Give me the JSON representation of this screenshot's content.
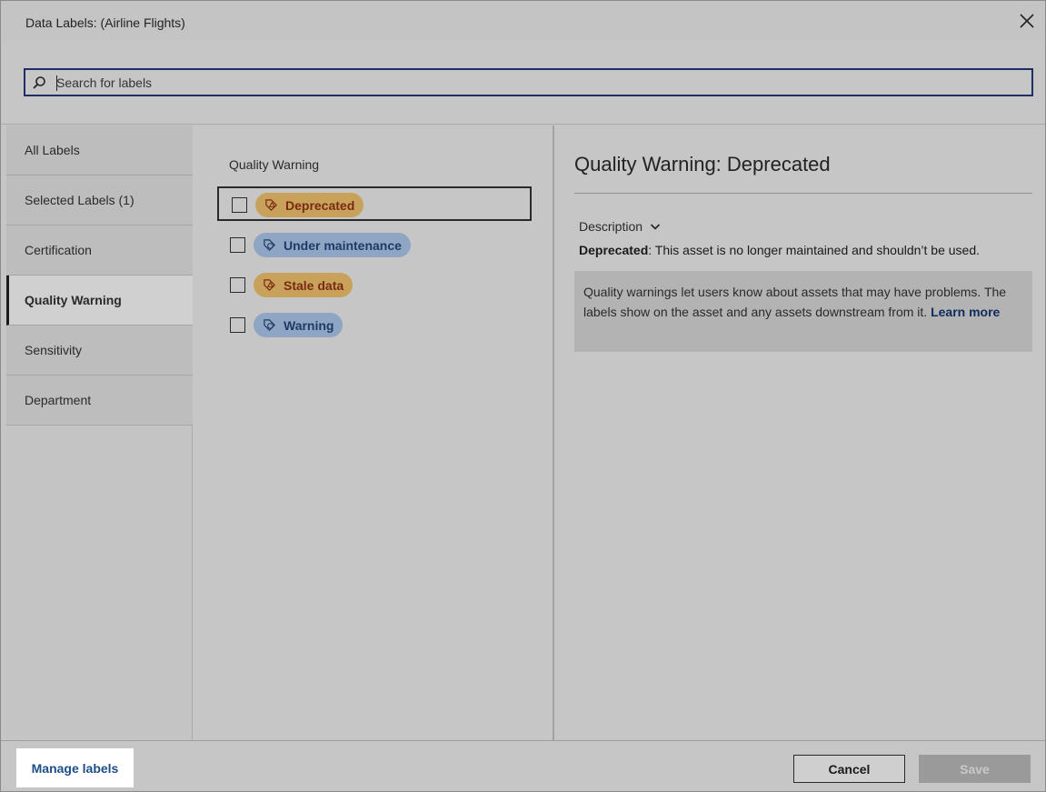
{
  "dialog": {
    "title": "Data Labels: (Airline Flights)"
  },
  "search": {
    "placeholder": "Search for labels",
    "value": ""
  },
  "sidebar": {
    "items": [
      {
        "label": "All Labels",
        "active": false
      },
      {
        "label": "Selected Labels (1)",
        "active": false
      },
      {
        "label": "Certification",
        "active": false
      },
      {
        "label": "Quality Warning",
        "active": true
      },
      {
        "label": "Sensitivity",
        "active": false
      },
      {
        "label": "Department",
        "active": false
      }
    ]
  },
  "labels_panel": {
    "group_title": "Quality Warning",
    "labels": [
      {
        "name": "Deprecated",
        "icon": "warning-tag-icon",
        "variant": "warn",
        "checked": false,
        "focused": true
      },
      {
        "name": "Under maintenance",
        "icon": "info-tag-icon",
        "variant": "info",
        "checked": false,
        "focused": false
      },
      {
        "name": "Stale data",
        "icon": "warning-tag-icon",
        "variant": "warn",
        "checked": false,
        "focused": false
      },
      {
        "name": "Warning",
        "icon": "info-tag-icon",
        "variant": "info",
        "checked": false,
        "focused": false
      }
    ]
  },
  "detail": {
    "title": "Quality Warning: Deprecated",
    "description_toggle": "Description",
    "description_term": "Deprecated",
    "description_text": ": This asset is no longer maintained and shouldn’t be used.",
    "info_text": "Quality warnings let users know about assets that may have problems. The labels show on the asset and any assets downstream from it.",
    "learn_more": "Learn more"
  },
  "footer": {
    "manage_label": "Manage labels",
    "cancel_label": "Cancel",
    "save_label": "Save"
  },
  "colors": {
    "warn_pill_bg": "#c8a25a",
    "warn_pill_text": "#7a2a12",
    "info_pill_bg": "#8ea6c4",
    "info_pill_text": "#1f3a66",
    "link": "#1d4e89",
    "search_border": "#1f2f66"
  }
}
